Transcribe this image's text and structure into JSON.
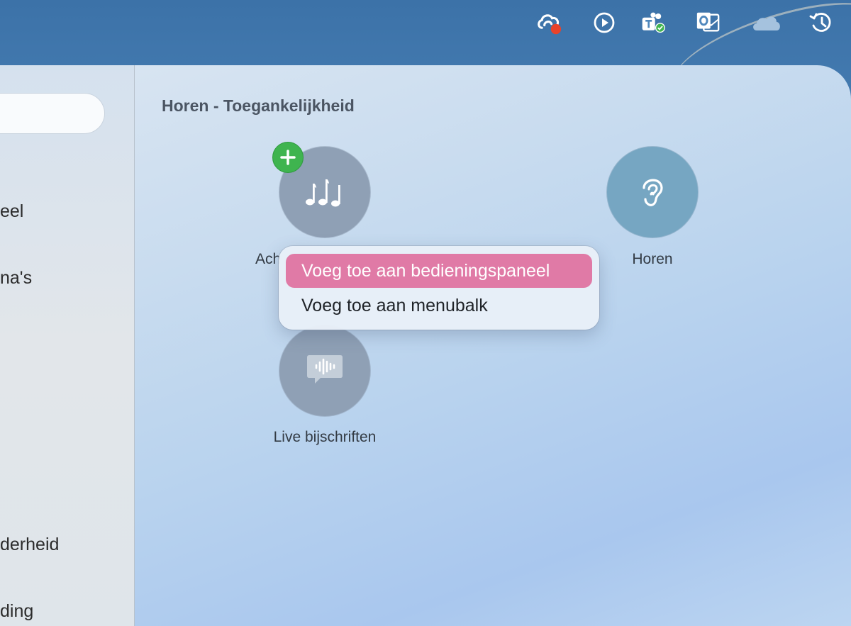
{
  "menubar": {
    "icons": [
      "creative-cloud-icon",
      "play-circle-icon",
      "teams-icon",
      "outlook-icon",
      "onedrive-icon",
      "time-machine-icon"
    ],
    "colors": {
      "notification_dot": "#e8432b",
      "status_check": "#3fb44f"
    }
  },
  "sidebar": {
    "items": [
      {
        "label": "eel"
      },
      {
        "label": "na's"
      },
      {
        "label": "derheid"
      },
      {
        "label": "ding"
      }
    ]
  },
  "content": {
    "title": "Horen - Toegankelijkheid",
    "tiles": [
      {
        "label": "Ach",
        "icon": "music-notes-icon"
      },
      {
        "label": "Horen",
        "icon": "ear-icon"
      },
      {
        "label": "Live bijschriften",
        "icon": "waveform-caption-icon"
      }
    ]
  },
  "context_menu": {
    "items": [
      {
        "label": "Voeg toe aan bedieningspaneel",
        "highlighted": true
      },
      {
        "label": "Voeg toe aan menubalk",
        "highlighted": false
      }
    ],
    "highlight_color": "#e07aa6"
  }
}
